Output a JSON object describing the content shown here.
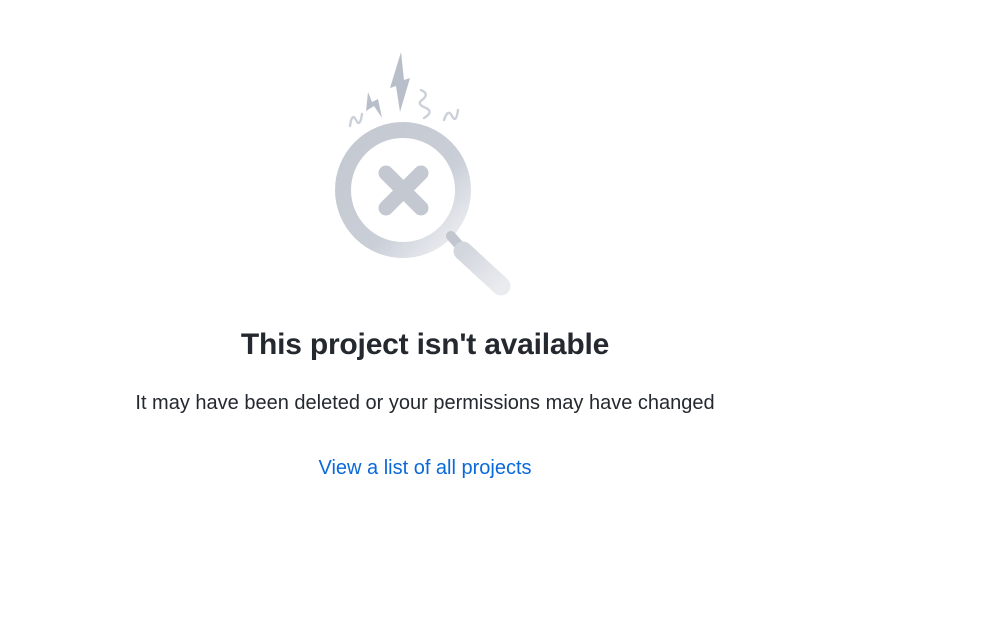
{
  "empty_state": {
    "illustration_icon": "magnifier-no-results-icon",
    "title": "This project isn't available",
    "description": "It may have been deleted or your permissions may have changed",
    "link_label": "View a list of all projects"
  },
  "colors": {
    "title": "#24292f",
    "text": "#24292f",
    "link": "#0969da",
    "illustration": "#c4c9d3"
  }
}
